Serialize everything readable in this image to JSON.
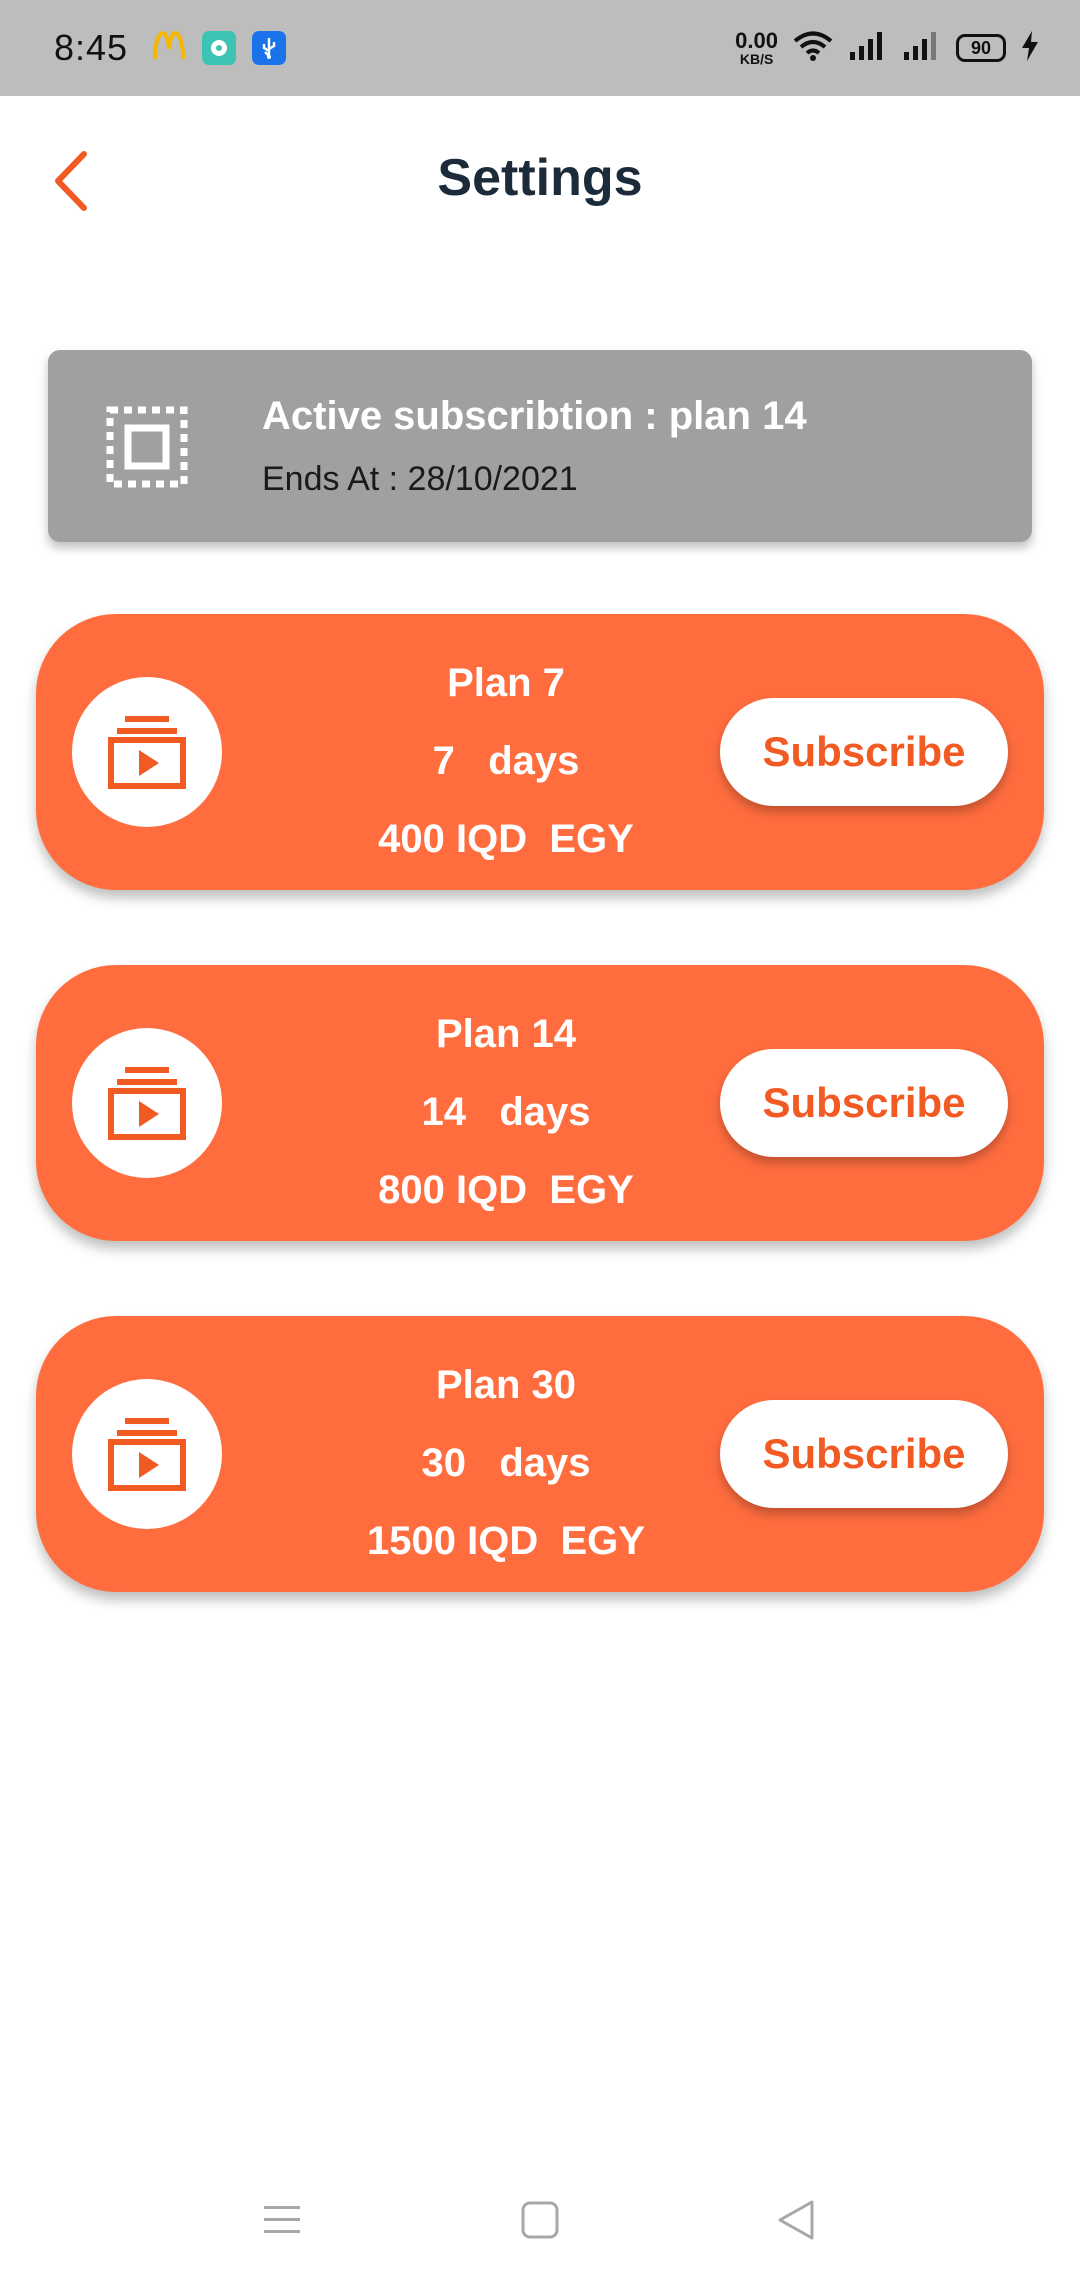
{
  "status_bar": {
    "time": "8:45",
    "net_speed_value": "0.00",
    "net_speed_unit": "KB/S",
    "battery": "90",
    "icons": [
      "mcdonalds-icon",
      "app-icon",
      "usb-icon",
      "wifi-icon",
      "signal-icon",
      "signal-icon",
      "charging-icon"
    ]
  },
  "header": {
    "title": "Settings",
    "back_icon": "chevron-left-icon"
  },
  "active_subscription": {
    "title": "Active subscribtion : plan 14",
    "ends": "Ends At : 28/10/2021"
  },
  "plans": [
    {
      "name": "Plan 7",
      "duration": "7   days",
      "price": "400 IQD  EGY",
      "button_label": "Subscribe"
    },
    {
      "name": "Plan 14",
      "duration": "14   days",
      "price": "800 IQD  EGY",
      "button_label": "Subscribe"
    },
    {
      "name": "Plan 30",
      "duration": "30   days",
      "price": "1500 IQD  EGY",
      "button_label": "Subscribe"
    }
  ],
  "nav_bar": {
    "items": [
      "menu-icon",
      "home-icon",
      "back-icon"
    ]
  },
  "colors": {
    "accent": "#ff6d3f",
    "accent_text": "#f25a24",
    "active_card": "#a0a0a0"
  }
}
